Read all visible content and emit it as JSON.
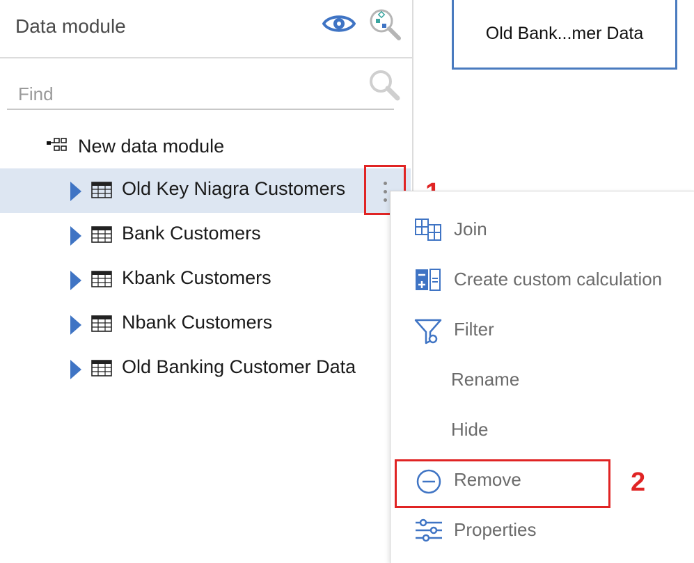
{
  "panel": {
    "title": "Data module",
    "icons": [
      "eye-icon",
      "relationships-search-icon"
    ]
  },
  "search": {
    "placeholder": "Find",
    "value": ""
  },
  "tree": {
    "root_label": "New data module",
    "items": [
      {
        "label": "Old Key Niagra Customers",
        "selected": true
      },
      {
        "label": "Bank Customers",
        "selected": false
      },
      {
        "label": "Kbank Customers",
        "selected": false
      },
      {
        "label": "Nbank Customers",
        "selected": false
      },
      {
        "label": "Old Banking Customer Data",
        "selected": false
      }
    ]
  },
  "context_menu": {
    "items": [
      {
        "label": "Join",
        "icon": "join-icon"
      },
      {
        "label": "Create custom calculation",
        "icon": "calculator-icon"
      },
      {
        "label": "Filter",
        "icon": "filter-icon"
      },
      {
        "label": "Rename",
        "icon": ""
      },
      {
        "label": "Hide",
        "icon": ""
      },
      {
        "label": "Remove",
        "icon": "minus-circle-icon"
      },
      {
        "label": "Properties",
        "icon": "sliders-icon"
      }
    ]
  },
  "annotations": {
    "step1": "1",
    "step2": "2"
  },
  "canvas": {
    "card_label": "Old Bank...mer Data"
  },
  "colors": {
    "accent": "#3f74c4",
    "selected_row": "#dde6f2",
    "highlight": "#e02424"
  }
}
